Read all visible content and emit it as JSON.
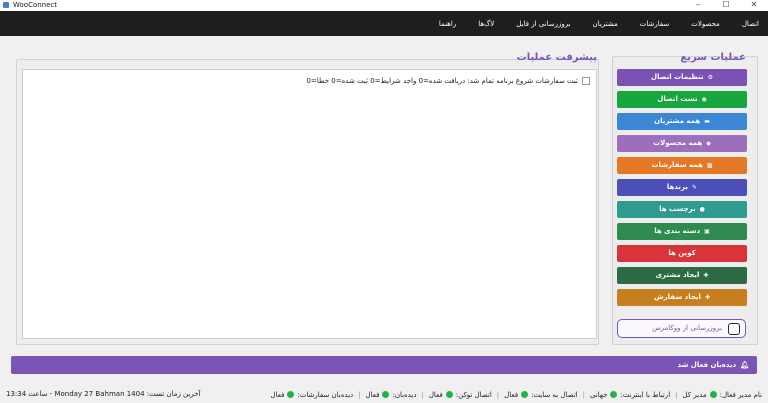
{
  "window": {
    "title": "WooConnect",
    "minimize": "–",
    "maximize": "☐",
    "close": "✕"
  },
  "menu": [
    "اتصال",
    "محصولات",
    "سفارشات",
    "مشتریان",
    "بروزرسانی از فایل",
    "لاگ‌ها",
    "راهنما"
  ],
  "quick": {
    "title": "عملیات سریع",
    "buttons": [
      {
        "label": "تنظیمات اتصال",
        "icon": "⚙",
        "color": "#7a52b3"
      },
      {
        "label": "تست اتصال",
        "icon": "◉",
        "color": "#17a640"
      },
      {
        "label": "همه مشتریان",
        "icon": "▬",
        "color": "#3c86d6"
      },
      {
        "label": "همه محصولات",
        "icon": "◆",
        "color": "#9c6fbe"
      },
      {
        "label": "همه سفارشات",
        "icon": "▦",
        "color": "#e47824"
      },
      {
        "label": "برندها",
        "icon": "✎",
        "color": "#4c4fb8"
      },
      {
        "label": "برچسب ها",
        "icon": "●",
        "color": "#2f9a8f"
      },
      {
        "label": "دسته بندی ها",
        "icon": "▣",
        "color": "#2f8a4f"
      },
      {
        "label": "کوپن ها",
        "icon": "",
        "color": "#d8343a"
      },
      {
        "label": "ایجاد مشتری",
        "icon": "✚",
        "color": "#2e6b44"
      },
      {
        "label": "ایجاد سفارش",
        "icon": "✚",
        "color": "#c77e1f"
      }
    ],
    "update_toggle": "بروزرسانی از ووکامرس"
  },
  "progress": {
    "title": "پیشرفت عملیات",
    "log": [
      "ثبت سفارشات شروع برنامه تمام شد: دریافت شده=0 واجد شرایط=0 ثبت شده=0 خطا=0"
    ]
  },
  "notification": {
    "icon": "bell-icon",
    "text": "دیده‌بان فعال شد"
  },
  "status": {
    "items": [
      {
        "label": "نام مدیر فعال:",
        "value": "مدیر کل"
      },
      {
        "label": "ارتباط با اینترنت:",
        "value": "جهانی"
      },
      {
        "label": "اتصال به سایت:",
        "value": "فعال"
      },
      {
        "label": "اتصال توکن:",
        "value": "فعال"
      },
      {
        "label": "دیده‌بان:",
        "value": "فعال"
      },
      {
        "label": "دیده‌بان سفارشات:",
        "value": "فعال"
      }
    ],
    "last_test": "آخرین زمان تست: Monday 27 Bahman 1404 - ساعت 13:34",
    "dot_color": "#22b14c"
  }
}
